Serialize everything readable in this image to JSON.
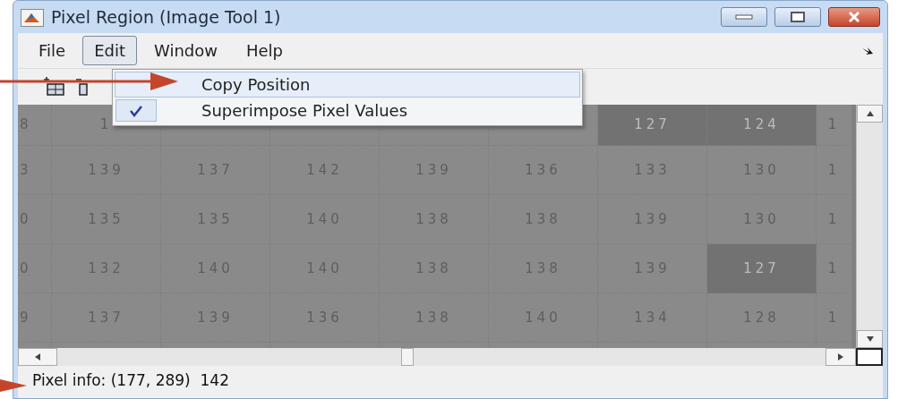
{
  "window": {
    "title": "Pixel Region (Image Tool 1)"
  },
  "menu_bar": [
    {
      "label": "File",
      "selected": false
    },
    {
      "label": "Edit",
      "selected": true
    },
    {
      "label": "Window",
      "selected": false
    },
    {
      "label": "Help",
      "selected": false
    }
  ],
  "edit_menu": [
    {
      "label": "Copy Position",
      "checked": false,
      "selected": true
    },
    {
      "label": "Superimpose Pixel Values",
      "checked": true,
      "selected": false
    }
  ],
  "grid": {
    "rows": [
      [
        {
          "text": "8",
          "dark": false
        },
        {
          "text": "1",
          "dark": false
        },
        null,
        null,
        null,
        null,
        {
          "text": "127",
          "dark": true
        },
        {
          "text": "124",
          "dark": true
        },
        {
          "text": "1",
          "dark": false
        }
      ],
      [
        {
          "text": "3",
          "dark": false
        },
        {
          "text": "139",
          "dark": false
        },
        {
          "text": "137",
          "dark": false
        },
        {
          "text": "142",
          "dark": false
        },
        {
          "text": "139",
          "dark": false
        },
        {
          "text": "136",
          "dark": false
        },
        {
          "text": "133",
          "dark": false
        },
        {
          "text": "130",
          "dark": false
        },
        {
          "text": "1",
          "dark": false
        }
      ],
      [
        {
          "text": "0",
          "dark": false
        },
        {
          "text": "135",
          "dark": false
        },
        {
          "text": "135",
          "dark": false
        },
        {
          "text": "140",
          "dark": false
        },
        {
          "text": "138",
          "dark": false
        },
        {
          "text": "138",
          "dark": false
        },
        {
          "text": "139",
          "dark": false
        },
        {
          "text": "130",
          "dark": false
        },
        {
          "text": "1",
          "dark": false
        }
      ],
      [
        {
          "text": "0",
          "dark": false
        },
        {
          "text": "132",
          "dark": false
        },
        {
          "text": "140",
          "dark": false
        },
        {
          "text": "140",
          "dark": false
        },
        {
          "text": "138",
          "dark": false
        },
        {
          "text": "138",
          "dark": false
        },
        {
          "text": "139",
          "dark": false
        },
        {
          "text": "127",
          "dark": true
        },
        {
          "text": "1",
          "dark": false
        }
      ],
      [
        {
          "text": "9",
          "dark": false
        },
        {
          "text": "137",
          "dark": false
        },
        {
          "text": "139",
          "dark": false
        },
        {
          "text": "136",
          "dark": false
        },
        {
          "text": "138",
          "dark": false
        },
        {
          "text": "140",
          "dark": false
        },
        {
          "text": "134",
          "dark": false
        },
        {
          "text": "128",
          "dark": false
        },
        {
          "text": "1",
          "dark": false
        }
      ]
    ]
  },
  "status_bar": "Pixel info: (177, 289)  142"
}
